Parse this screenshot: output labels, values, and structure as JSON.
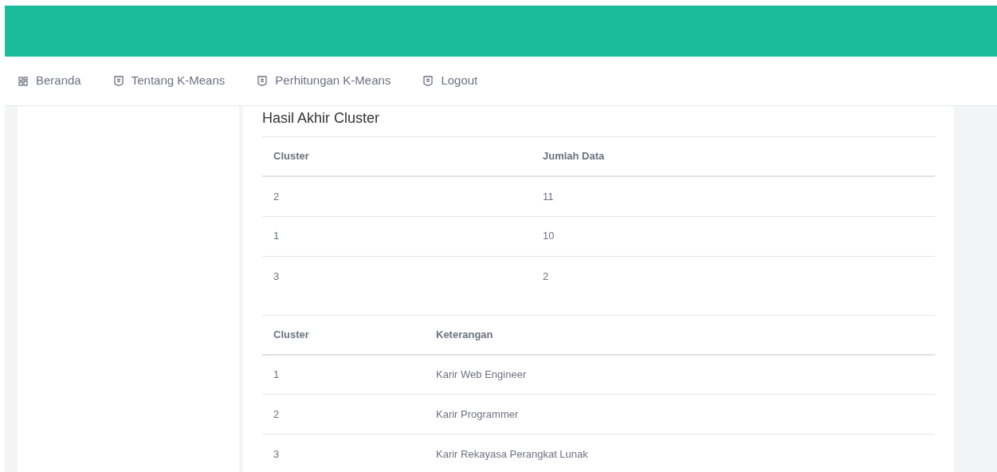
{
  "nav": [
    {
      "label": "Beranda",
      "kind": "grid"
    },
    {
      "label": "Tentang K-Means",
      "kind": "document"
    },
    {
      "label": "Perhitungan K-Means",
      "kind": "document"
    },
    {
      "label": "Logout",
      "kind": "document"
    }
  ],
  "content": {
    "title": "Hasil Akhir Cluster",
    "tables": [
      {
        "columns": [
          "Cluster",
          "Jumlah Data"
        ],
        "rows": [
          [
            "2",
            "11"
          ],
          [
            "1",
            "10"
          ],
          [
            "3",
            "2"
          ]
        ]
      },
      {
        "columns": [
          "Cluster",
          "Keterangan"
        ],
        "rows": [
          [
            "1",
            "Karir Web Engineer"
          ],
          [
            "2",
            "Karir Programmer"
          ],
          [
            "3",
            "Karir Rekayasa Perangkat Lunak"
          ]
        ]
      }
    ]
  }
}
